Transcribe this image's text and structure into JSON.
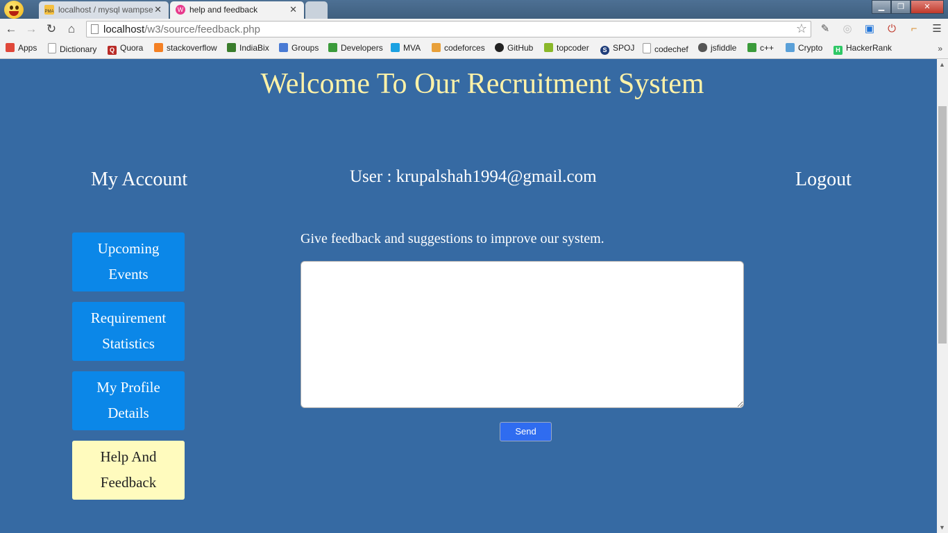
{
  "browser": {
    "tabs": [
      {
        "label": "localhost / mysql wampse",
        "favicon": "phpmyadmin-icon",
        "active": false
      },
      {
        "label": "help and feedback",
        "favicon": "help-feedback-icon",
        "active": true
      }
    ],
    "url_host": "localhost",
    "url_path": "/w3/source/feedback.php",
    "bookmarks": [
      {
        "label": "Apps",
        "icon": "apps-grid-icon",
        "color": "#e0483a"
      },
      {
        "label": "Dictionary",
        "icon": "page-icon",
        "color": "#ffffff"
      },
      {
        "label": "Quora",
        "icon": "quora-icon",
        "color": "#b92b27"
      },
      {
        "label": "stackoverflow",
        "icon": "stackoverflow-icon",
        "color": "#f48024"
      },
      {
        "label": "IndiaBix",
        "icon": "indiabix-icon",
        "color": "#3a7d2c"
      },
      {
        "label": "Groups",
        "icon": "groups-icon",
        "color": "#4a7bd4"
      },
      {
        "label": "Developers",
        "icon": "developers-icon",
        "color": "#3b9b3b"
      },
      {
        "label": "MVA",
        "icon": "mva-icon",
        "color": "#1ba1e2"
      },
      {
        "label": "codeforces",
        "icon": "codeforces-icon",
        "color": "#e8a03a"
      },
      {
        "label": "GitHub",
        "icon": "github-icon",
        "color": "#222222"
      },
      {
        "label": "topcoder",
        "icon": "topcoder-icon",
        "color": "#8ab82a"
      },
      {
        "label": "SPOJ",
        "icon": "spoj-icon",
        "color": "#1f3d7a"
      },
      {
        "label": "codechef",
        "icon": "page-icon",
        "color": "#ffffff"
      },
      {
        "label": "jsfiddle",
        "icon": "jsfiddle-icon",
        "color": "#555555"
      },
      {
        "label": "c++",
        "icon": "cpp-icon",
        "color": "#3b9b3b"
      },
      {
        "label": "Crypto",
        "icon": "crypto-icon",
        "color": "#5aa0d8"
      },
      {
        "label": "HackerRank",
        "icon": "hackerrank-icon",
        "color": "#2ec866"
      }
    ],
    "bookmarks_more": "»"
  },
  "page": {
    "welcome": "Welcome To Our Recruitment System",
    "my_account": "My Account",
    "user_line": "User : krupalshah1994@gmail.com",
    "logout": "Logout",
    "menu": [
      {
        "line1": "Upcoming",
        "line2": "Events",
        "active": false
      },
      {
        "line1": "Requirement",
        "line2": "Statistics",
        "active": false
      },
      {
        "line1": "My Profile",
        "line2": "Details",
        "active": false
      },
      {
        "line1": "Help And",
        "line2": "Feedback",
        "active": true
      }
    ],
    "feedback_prompt": "Give feedback and suggestions to improve our system.",
    "feedback_value": "",
    "send_label": "Send"
  },
  "colors": {
    "page_bg": "#366aa3",
    "heading": "#fff2a8",
    "menu_button": "#0b87e8",
    "menu_active": "#fffbbe",
    "send_button": "#2f6cf0"
  }
}
